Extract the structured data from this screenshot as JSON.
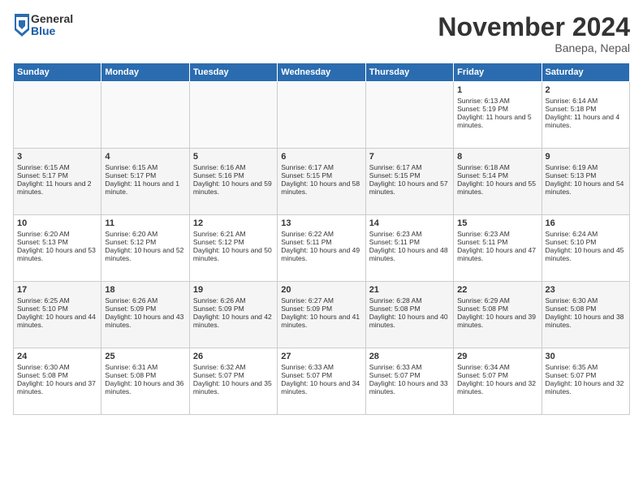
{
  "header": {
    "logo_general": "General",
    "logo_blue": "Blue",
    "month_title": "November 2024",
    "location": "Banepa, Nepal"
  },
  "weekdays": [
    "Sunday",
    "Monday",
    "Tuesday",
    "Wednesday",
    "Thursday",
    "Friday",
    "Saturday"
  ],
  "weeks": [
    [
      {
        "day": "",
        "content": ""
      },
      {
        "day": "",
        "content": ""
      },
      {
        "day": "",
        "content": ""
      },
      {
        "day": "",
        "content": ""
      },
      {
        "day": "",
        "content": ""
      },
      {
        "day": "1",
        "content": "Sunrise: 6:13 AM\nSunset: 5:19 PM\nDaylight: 11 hours and 5 minutes."
      },
      {
        "day": "2",
        "content": "Sunrise: 6:14 AM\nSunset: 5:18 PM\nDaylight: 11 hours and 4 minutes."
      }
    ],
    [
      {
        "day": "3",
        "content": "Sunrise: 6:15 AM\nSunset: 5:17 PM\nDaylight: 11 hours and 2 minutes."
      },
      {
        "day": "4",
        "content": "Sunrise: 6:15 AM\nSunset: 5:17 PM\nDaylight: 11 hours and 1 minute."
      },
      {
        "day": "5",
        "content": "Sunrise: 6:16 AM\nSunset: 5:16 PM\nDaylight: 10 hours and 59 minutes."
      },
      {
        "day": "6",
        "content": "Sunrise: 6:17 AM\nSunset: 5:15 PM\nDaylight: 10 hours and 58 minutes."
      },
      {
        "day": "7",
        "content": "Sunrise: 6:17 AM\nSunset: 5:15 PM\nDaylight: 10 hours and 57 minutes."
      },
      {
        "day": "8",
        "content": "Sunrise: 6:18 AM\nSunset: 5:14 PM\nDaylight: 10 hours and 55 minutes."
      },
      {
        "day": "9",
        "content": "Sunrise: 6:19 AM\nSunset: 5:13 PM\nDaylight: 10 hours and 54 minutes."
      }
    ],
    [
      {
        "day": "10",
        "content": "Sunrise: 6:20 AM\nSunset: 5:13 PM\nDaylight: 10 hours and 53 minutes."
      },
      {
        "day": "11",
        "content": "Sunrise: 6:20 AM\nSunset: 5:12 PM\nDaylight: 10 hours and 52 minutes."
      },
      {
        "day": "12",
        "content": "Sunrise: 6:21 AM\nSunset: 5:12 PM\nDaylight: 10 hours and 50 minutes."
      },
      {
        "day": "13",
        "content": "Sunrise: 6:22 AM\nSunset: 5:11 PM\nDaylight: 10 hours and 49 minutes."
      },
      {
        "day": "14",
        "content": "Sunrise: 6:23 AM\nSunset: 5:11 PM\nDaylight: 10 hours and 48 minutes."
      },
      {
        "day": "15",
        "content": "Sunrise: 6:23 AM\nSunset: 5:11 PM\nDaylight: 10 hours and 47 minutes."
      },
      {
        "day": "16",
        "content": "Sunrise: 6:24 AM\nSunset: 5:10 PM\nDaylight: 10 hours and 45 minutes."
      }
    ],
    [
      {
        "day": "17",
        "content": "Sunrise: 6:25 AM\nSunset: 5:10 PM\nDaylight: 10 hours and 44 minutes."
      },
      {
        "day": "18",
        "content": "Sunrise: 6:26 AM\nSunset: 5:09 PM\nDaylight: 10 hours and 43 minutes."
      },
      {
        "day": "19",
        "content": "Sunrise: 6:26 AM\nSunset: 5:09 PM\nDaylight: 10 hours and 42 minutes."
      },
      {
        "day": "20",
        "content": "Sunrise: 6:27 AM\nSunset: 5:09 PM\nDaylight: 10 hours and 41 minutes."
      },
      {
        "day": "21",
        "content": "Sunrise: 6:28 AM\nSunset: 5:08 PM\nDaylight: 10 hours and 40 minutes."
      },
      {
        "day": "22",
        "content": "Sunrise: 6:29 AM\nSunset: 5:08 PM\nDaylight: 10 hours and 39 minutes."
      },
      {
        "day": "23",
        "content": "Sunrise: 6:30 AM\nSunset: 5:08 PM\nDaylight: 10 hours and 38 minutes."
      }
    ],
    [
      {
        "day": "24",
        "content": "Sunrise: 6:30 AM\nSunset: 5:08 PM\nDaylight: 10 hours and 37 minutes."
      },
      {
        "day": "25",
        "content": "Sunrise: 6:31 AM\nSunset: 5:08 PM\nDaylight: 10 hours and 36 minutes."
      },
      {
        "day": "26",
        "content": "Sunrise: 6:32 AM\nSunset: 5:07 PM\nDaylight: 10 hours and 35 minutes."
      },
      {
        "day": "27",
        "content": "Sunrise: 6:33 AM\nSunset: 5:07 PM\nDaylight: 10 hours and 34 minutes."
      },
      {
        "day": "28",
        "content": "Sunrise: 6:33 AM\nSunset: 5:07 PM\nDaylight: 10 hours and 33 minutes."
      },
      {
        "day": "29",
        "content": "Sunrise: 6:34 AM\nSunset: 5:07 PM\nDaylight: 10 hours and 32 minutes."
      },
      {
        "day": "30",
        "content": "Sunrise: 6:35 AM\nSunset: 5:07 PM\nDaylight: 10 hours and 32 minutes."
      }
    ]
  ]
}
